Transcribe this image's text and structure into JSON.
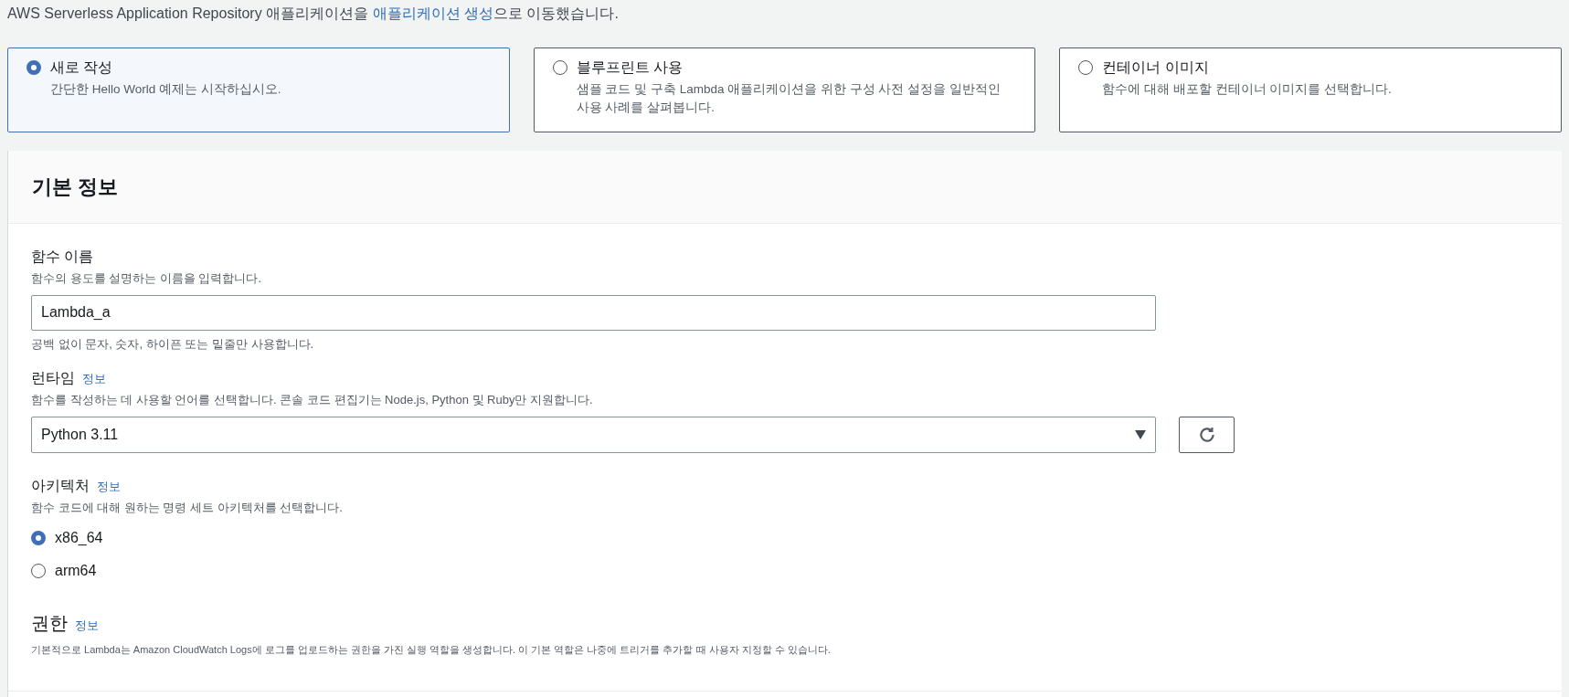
{
  "notice": {
    "before": "AWS Serverless Application Repository 애플리케이션을 ",
    "link": "애플리케이션 생성",
    "after": "으로 이동했습니다."
  },
  "options": [
    {
      "title": "새로 작성",
      "description": "간단한 Hello World 예제는 시작하십시오.",
      "selected": true
    },
    {
      "title": "블루프린트 사용",
      "description": "샘플 코드 및 구축 Lambda 애플리케이션을 위한 구성 사전 설정을 일반적인 사용 사례를 살펴봅니다.",
      "selected": false
    },
    {
      "title": "컨테이너 이미지",
      "description": "함수에 대해 배포할 컨테이너 이미지를 선택합니다.",
      "selected": false
    }
  ],
  "panel": {
    "title": "기본 정보",
    "function_name": {
      "label": "함수 이름",
      "description": "함수의 용도를 설명하는 이름을 입력합니다.",
      "value": "Lambda_a",
      "constraint": "공백 없이 문자, 숫자, 하이픈 또는 밑줄만 사용합니다."
    },
    "runtime": {
      "label": "런타임",
      "info": "정보",
      "description": "함수를 작성하는 데 사용할 언어를 선택합니다. 콘솔 코드 편집기는 Node.js, Python 및 Ruby만 지원합니다.",
      "value": "Python 3.11"
    },
    "architecture": {
      "label": "아키텍처",
      "info": "정보",
      "description": "함수 코드에 대해 원하는 명령 세트 아키텍처를 선택합니다.",
      "choices": [
        {
          "label": "x86_64",
          "selected": true
        },
        {
          "label": "arm64",
          "selected": false
        }
      ]
    },
    "permissions": {
      "title": "권한",
      "info": "정보",
      "description": "기본적으로 Lambda는 Amazon CloudWatch Logs에 로그를 업로드하는 권한을 가진 실행 역할을 생성합니다. 이 기본 역할은 나중에 트리거를 추가할 때 사용자 지정할 수 있습니다."
    }
  }
}
